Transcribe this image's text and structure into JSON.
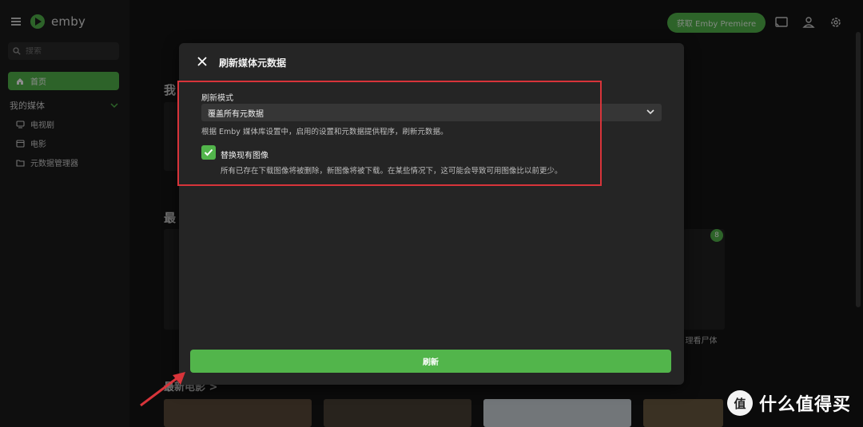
{
  "sidebar": {
    "brand": "emby",
    "search_placeholder": "搜索",
    "home_label": "首页",
    "library_section": "我的媒体",
    "items": [
      {
        "label": "电视剧",
        "icon": "tv-icon"
      },
      {
        "label": "电影",
        "icon": "film-icon"
      },
      {
        "label": "元数据管理器",
        "icon": "folder-icon"
      }
    ]
  },
  "topbar": {
    "premiere_label": "获取 Emby Premiere",
    "icons": [
      "cast-icon",
      "user-icon",
      "gear-icon"
    ]
  },
  "background": {
    "heading1": "我",
    "heading2": "最",
    "heading3": "最新电影 >",
    "badge_count": "8",
    "caption": "5 理看尸体"
  },
  "dialog": {
    "title": "刷新媒体元数据",
    "mode_label": "刷新模式",
    "mode_value": "覆盖所有元数据",
    "mode_description": "根据 Emby 媒体库设置中，启用的设置和元数据提供程序，刷新元数据。",
    "replace_images_label": "替换现有图像",
    "replace_images_checked": true,
    "replace_images_description": "所有已存在下载图像将被删除，新图像将被下载。在某些情况下，这可能会导致可用图像比以前更少。",
    "refresh_button": "刷新"
  },
  "watermark": {
    "text": "什么值得买",
    "logo_glyph": "值"
  },
  "colors": {
    "accent": "#52b54b",
    "annotation": "#d8343a"
  }
}
